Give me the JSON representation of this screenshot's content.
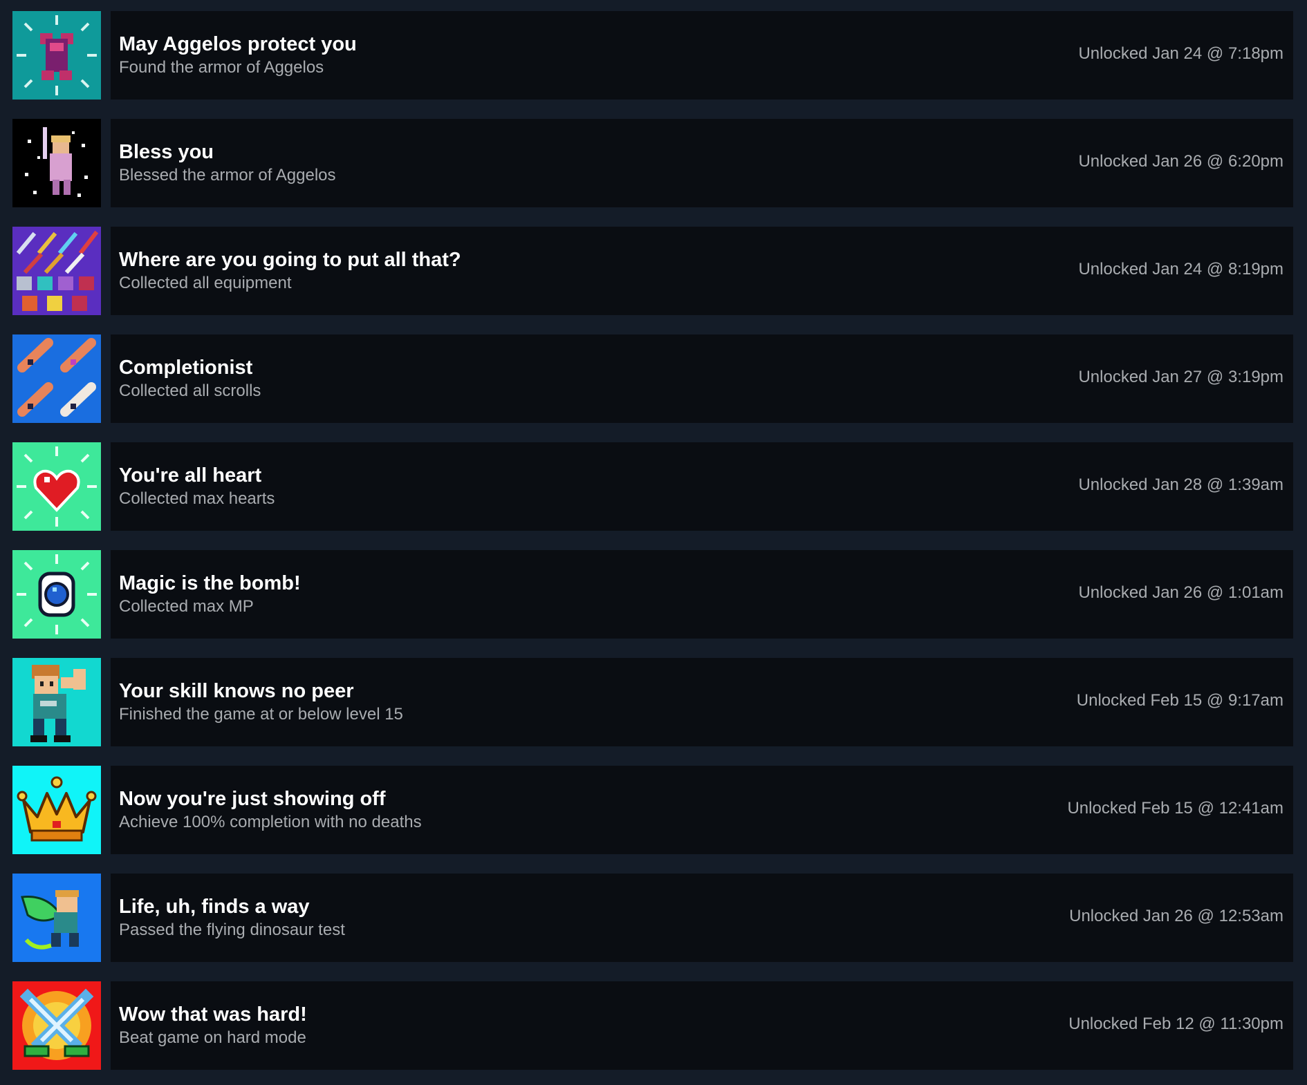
{
  "achievements": [
    {
      "title": "May Aggelos protect you",
      "description": "Found the armor of Aggelos",
      "unlocked": "Unlocked Jan 24 @ 7:18pm",
      "icon": "armor-icon",
      "icon_bg": "#0f9a9a"
    },
    {
      "title": "Bless you",
      "description": "Blessed the armor of Aggelos",
      "unlocked": "Unlocked Jan 26 @ 6:20pm",
      "icon": "blessed-hero-icon",
      "icon_bg": "#000000"
    },
    {
      "title": "Where are you going to put all that?",
      "description": "Collected all equipment",
      "unlocked": "Unlocked Jan 24 @ 8:19pm",
      "icon": "equipment-icon",
      "icon_bg": "#5a2ec0"
    },
    {
      "title": "Completionist",
      "description": "Collected all scrolls",
      "unlocked": "Unlocked Jan 27 @ 3:19pm",
      "icon": "scrolls-icon",
      "icon_bg": "#1a6ee0"
    },
    {
      "title": "You're all heart",
      "description": "Collected max hearts",
      "unlocked": "Unlocked Jan 28 @ 1:39am",
      "icon": "heart-icon",
      "icon_bg": "#3ee89a"
    },
    {
      "title": "Magic is the bomb!",
      "description": "Collected max MP",
      "unlocked": "Unlocked Jan 26 @ 1:01am",
      "icon": "magic-orb-icon",
      "icon_bg": "#3ee89a"
    },
    {
      "title": "Your skill knows no peer",
      "description": "Finished the game at or below level 15",
      "unlocked": "Unlocked Feb 15 @ 9:17am",
      "icon": "flexing-hero-icon",
      "icon_bg": "#12d8d0"
    },
    {
      "title": "Now you're just showing off",
      "description": "Achieve 100% completion with no deaths",
      "unlocked": "Unlocked Feb 15 @ 12:41am",
      "icon": "crown-icon",
      "icon_bg": "#10f4f8"
    },
    {
      "title": "Life, uh, finds a way",
      "description": "Passed the flying dinosaur test",
      "unlocked": "Unlocked Jan 26 @ 12:53am",
      "icon": "flying-hero-icon",
      "icon_bg": "#1878f0"
    },
    {
      "title": "Wow that was hard!",
      "description": "Beat game on hard mode",
      "unlocked": "Unlocked Feb 12 @ 11:30pm",
      "icon": "crossed-swords-icon",
      "icon_bg": "#f01818"
    }
  ]
}
